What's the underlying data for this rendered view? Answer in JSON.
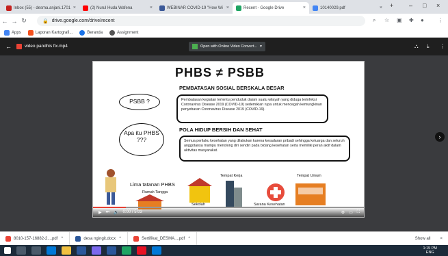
{
  "browser": {
    "tabs": [
      {
        "label": "Inbox (55) - desma.anjani.1701",
        "color": "#c5221f"
      },
      {
        "label": "(2) Nurul Huda Wafena",
        "color": "#ff0000"
      },
      {
        "label": "WEBINAR COVID-19 \"How Wi",
        "color": "#3b5998"
      },
      {
        "label": "Recent - Google Drive",
        "color": "#1fa463"
      },
      {
        "label": "10140029.pdf",
        "color": "#4285f4"
      }
    ],
    "new_tab": "+",
    "address": "drive.google.com/drive/recent",
    "bookmarks": [
      {
        "label": "Apps"
      },
      {
        "label": "Laporan Kartografi..."
      },
      {
        "label": "Beranda"
      },
      {
        "label": "Assignment"
      }
    ]
  },
  "viewer": {
    "file_name": "video pandhis fix.mp4",
    "open_with": "Open with Online Video Convert..."
  },
  "slide": {
    "title": "PHBS ≠ PSBB",
    "psbb_heading": "PEMBATASAN SOSIAL BERSKALA BESAR",
    "psbb_text": "Pembatasan kegiatan tertentu penduduk dalam suatu wilayah yang diduga terinfeksi Coronavirus Disease 2019 (COVID-19) sedemikian rupa untuk mencegah kemungkinan penyebaran Coronavirus Disease 2019 (COVID-19).",
    "phbs_heading": "POLA HIDUP BERSIH DAN SEHAT",
    "phbs_text": "Semua perilaku kesehatan yang dilakukan karena kesadaran pribadi sehingga keluarga dan seluruh anggotanya mampu menolong diri sendiri pada bidang kesehatan serta memiliki peran aktif dalam aktivitas masyarakat.",
    "bubble1": "PSBB ?",
    "bubble2": "Apa itu PHBS ???",
    "lima": "Lima tatanan PHBS",
    "labels": {
      "rumah": "Rumah Tangga",
      "sekolah": "Sekolah",
      "kerja": "Tempat Kerja",
      "sarana": "Sarana Kesehatan",
      "umum": "Tempat Umum"
    },
    "time": "0:00 / 5:03"
  },
  "downloads": [
    {
      "label": "8010-157-16882-2....pdf"
    },
    {
      "label": "desa ngingit.docx"
    },
    {
      "label": "Sertifikat_DESMA....pdf"
    }
  ],
  "show_all": "Show all",
  "clock": {
    "time": "1:15 PM",
    "date": "ENG"
  }
}
